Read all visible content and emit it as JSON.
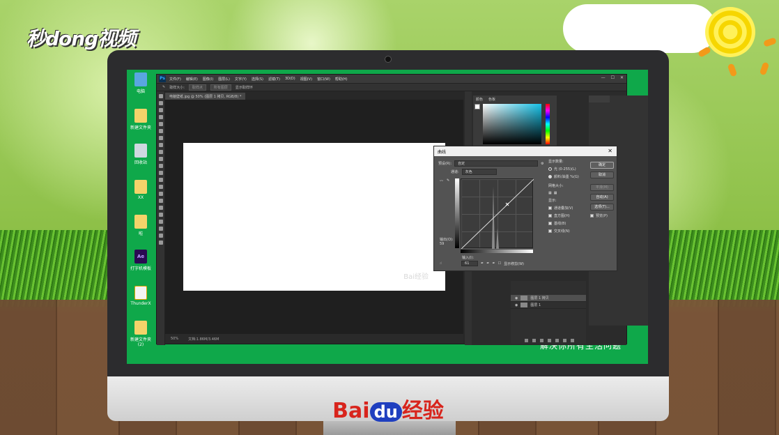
{
  "brand": {
    "top_logo": "秒dong视频",
    "baidu_bai": "Bai",
    "baidu_du": "du",
    "baidu_jingyan": "经验",
    "slogan": "解决你所有生活问题"
  },
  "desktop": {
    "icons": [
      {
        "label": "电脑",
        "kind": "pc"
      },
      {
        "label": "新建文件夹",
        "kind": "folder"
      },
      {
        "label": "回收站",
        "kind": "bin"
      },
      {
        "label": "XX",
        "kind": "folder"
      },
      {
        "label": "啦",
        "kind": "folder"
      },
      {
        "label": "打字机模板",
        "kind": "ae",
        "glyph": "Ae"
      },
      {
        "label": "ThunderX",
        "kind": "thunder"
      },
      {
        "label": "新建文件夹 (2)",
        "kind": "folder"
      }
    ]
  },
  "photoshop": {
    "logo": "Ps",
    "menu": [
      "文件(F)",
      "编辑(E)",
      "图像(I)",
      "图层(L)",
      "文字(Y)",
      "选择(S)",
      "滤镜(T)",
      "3D(D)",
      "视图(V)",
      "窗口(W)",
      "帮助(H)"
    ],
    "window_controls": [
      "—",
      "☐",
      "✕"
    ],
    "options": {
      "sample_label": "取样大小:",
      "sample_value": "取样点",
      "layer_label": "所有图层",
      "show_ring": "显示取样环"
    },
    "doc_tab": "电脑壁纸.jpg @ 50% (图层 1 拷贝, RGB/8) *",
    "status": {
      "zoom": "50%",
      "doc": "文档:1.86M/3.46M"
    },
    "color_tabs": [
      "颜色",
      "色板"
    ],
    "layers": [
      {
        "name": "图层 1 拷贝",
        "selected": true
      },
      {
        "name": "图层 1",
        "selected": false
      }
    ],
    "watermark": "Bai经验"
  },
  "curves_dialog": {
    "title": "曲线",
    "preset_label": "预设(R):",
    "preset_value": "自定",
    "channel_label": "通道:",
    "channel_value": "灰色",
    "output_label": "输出(O):",
    "output_value": "59",
    "input_label": "输入(I):",
    "input_value": "61",
    "show_clipping": "显示修剪(W)",
    "display_amount": "显示数量:",
    "light_option": "光 (0-255)(L)",
    "pigment_option": "颜料/油墨 %(G)",
    "grid_size": "网格大小:",
    "show": "显示:",
    "show_options": [
      {
        "label": "通道叠加(V)",
        "checked": true
      },
      {
        "label": "直方图(H)",
        "checked": true
      },
      {
        "label": "基线(B)",
        "checked": true
      },
      {
        "label": "交叉线(N)",
        "checked": true
      }
    ],
    "buttons": {
      "ok": "确定",
      "cancel": "取消",
      "smooth": "平滑(M)",
      "auto": "自动(A)",
      "options": "选项(T)...",
      "preview": "预览(P)"
    }
  }
}
